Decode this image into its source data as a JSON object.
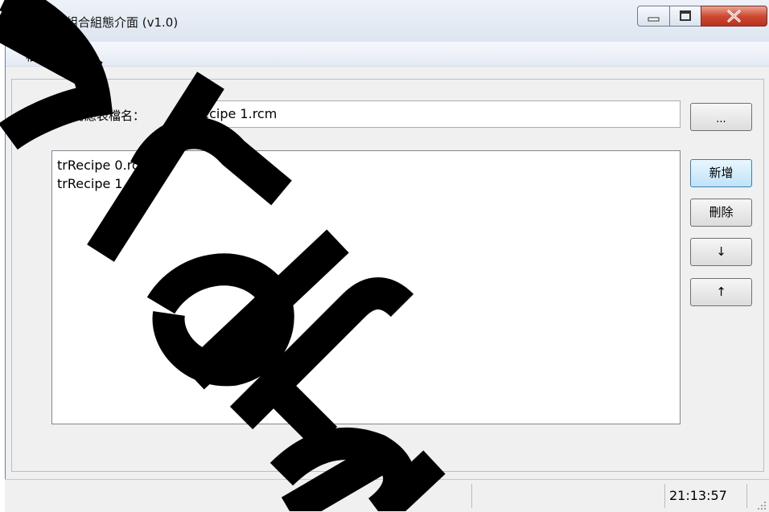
{
  "window": {
    "title": "配方組合組態介面 (v1.0)",
    "controls": {
      "minimize": "minimize",
      "maximize": "maximize",
      "close": "X"
    }
  },
  "menu": {
    "file": "檔案(F)"
  },
  "form": {
    "filename_label": "配方對應表檔名：",
    "filename_value": "trRecipe 1.rcm",
    "browse_label": "..."
  },
  "recipes": [
    "trRecipe 0.rcm",
    "trRecipe 1.rcm"
  ],
  "buttons": {
    "add": "新增",
    "delete": "刪除",
    "down": "↓",
    "up": "↑"
  },
  "status": {
    "time": "21:13:57"
  },
  "colors": {
    "watermark": "#000000",
    "close_button": "#c94a36"
  }
}
